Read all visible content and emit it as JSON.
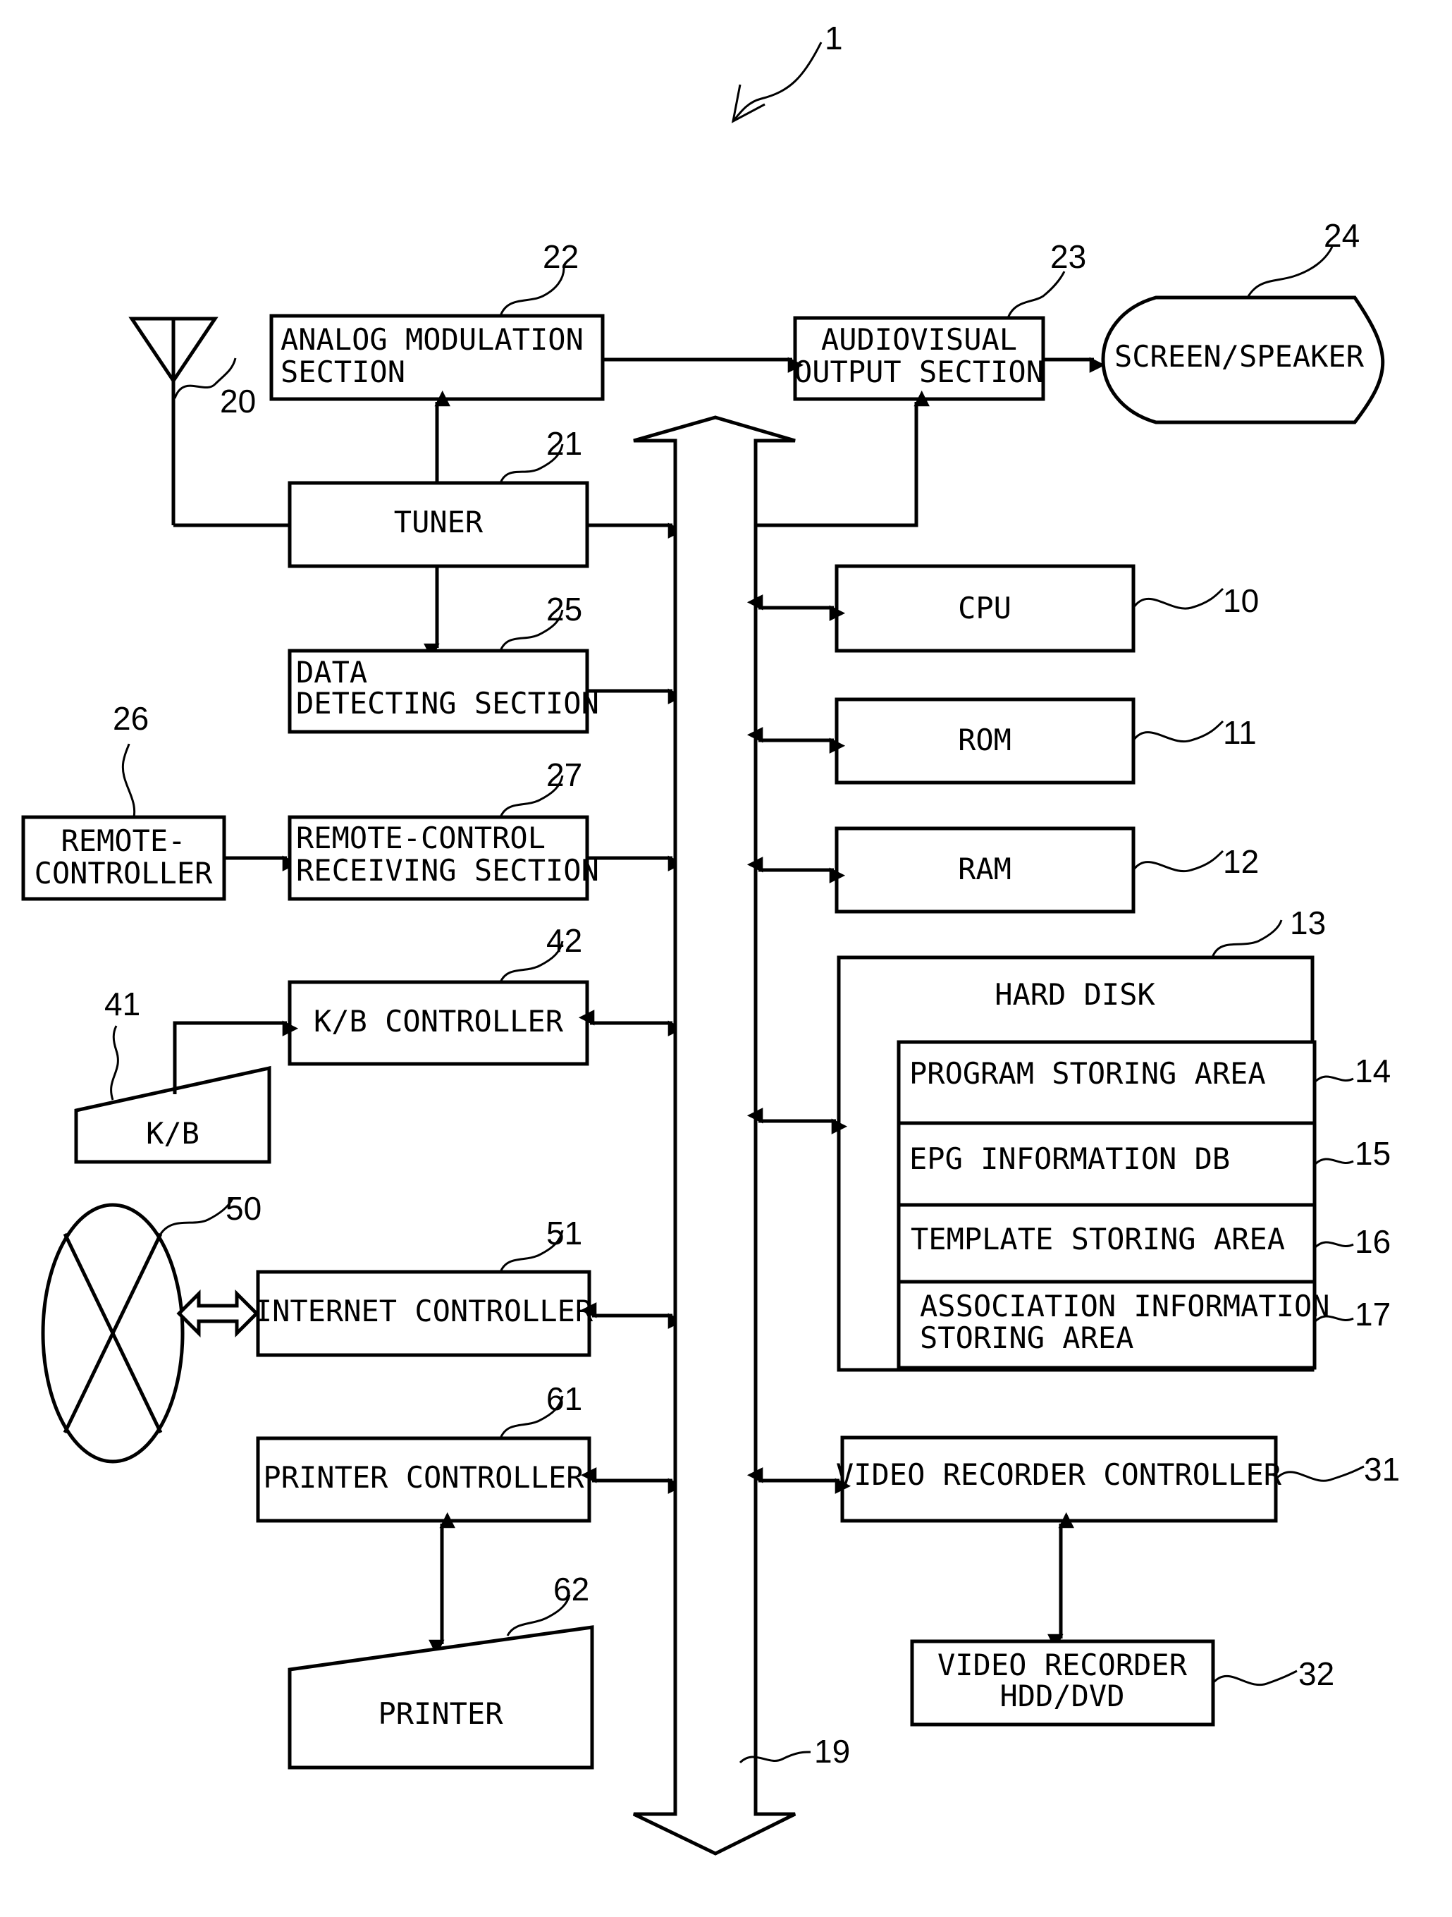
{
  "figure_ref": "1",
  "blocks": {
    "analog_modulation": {
      "ref": "22",
      "lines": [
        "ANALOG MODULATION",
        "SECTION"
      ]
    },
    "audiovisual_output": {
      "ref": "23",
      "lines": [
        "AUDIOVISUAL",
        "OUTPUT SECTION"
      ]
    },
    "screen_speaker": {
      "ref": "24",
      "label": "SCREEN/SPEAKER"
    },
    "antenna": {
      "ref": "20"
    },
    "tuner": {
      "ref": "21",
      "label": "TUNER"
    },
    "data_detecting": {
      "ref": "25",
      "lines": [
        "DATA",
        "DETECTING SECTION"
      ]
    },
    "remote_controller": {
      "ref": "26",
      "lines": [
        "REMOTE-",
        "CONTROLLER"
      ]
    },
    "remote_control_receiving": {
      "ref": "27",
      "lines": [
        "REMOTE-CONTROL",
        "RECEIVING SECTION"
      ]
    },
    "kb_controller": {
      "ref": "42",
      "label": "K/B CONTROLLER"
    },
    "kb": {
      "ref": "41",
      "label": "K/B"
    },
    "internet": {
      "ref": "50"
    },
    "internet_controller": {
      "ref": "51",
      "label": "INTERNET CONTROLLER"
    },
    "printer_controller": {
      "ref": "61",
      "label": "PRINTER CONTROLLER"
    },
    "printer": {
      "ref": "62",
      "label": "PRINTER"
    },
    "cpu": {
      "ref": "10",
      "label": "CPU"
    },
    "rom": {
      "ref": "11",
      "label": "ROM"
    },
    "ram": {
      "ref": "12",
      "label": "RAM"
    },
    "hard_disk": {
      "ref": "13",
      "label": "HARD DISK",
      "areas": [
        {
          "ref": "14",
          "lines": [
            "PROGRAM STORING AREA"
          ]
        },
        {
          "ref": "15",
          "lines": [
            "EPG INFORMATION DB"
          ]
        },
        {
          "ref": "16",
          "lines": [
            "TEMPLATE STORING AREA"
          ]
        },
        {
          "ref": "17",
          "lines": [
            "ASSOCIATION INFORMATION",
            "STORING AREA"
          ]
        }
      ]
    },
    "video_recorder_controller": {
      "ref": "31",
      "label": "VIDEO RECORDER CONTROLLER"
    },
    "video_recorder": {
      "ref": "32",
      "lines": [
        "VIDEO RECORDER",
        "HDD/DVD"
      ]
    },
    "bus": {
      "ref": "19"
    }
  }
}
